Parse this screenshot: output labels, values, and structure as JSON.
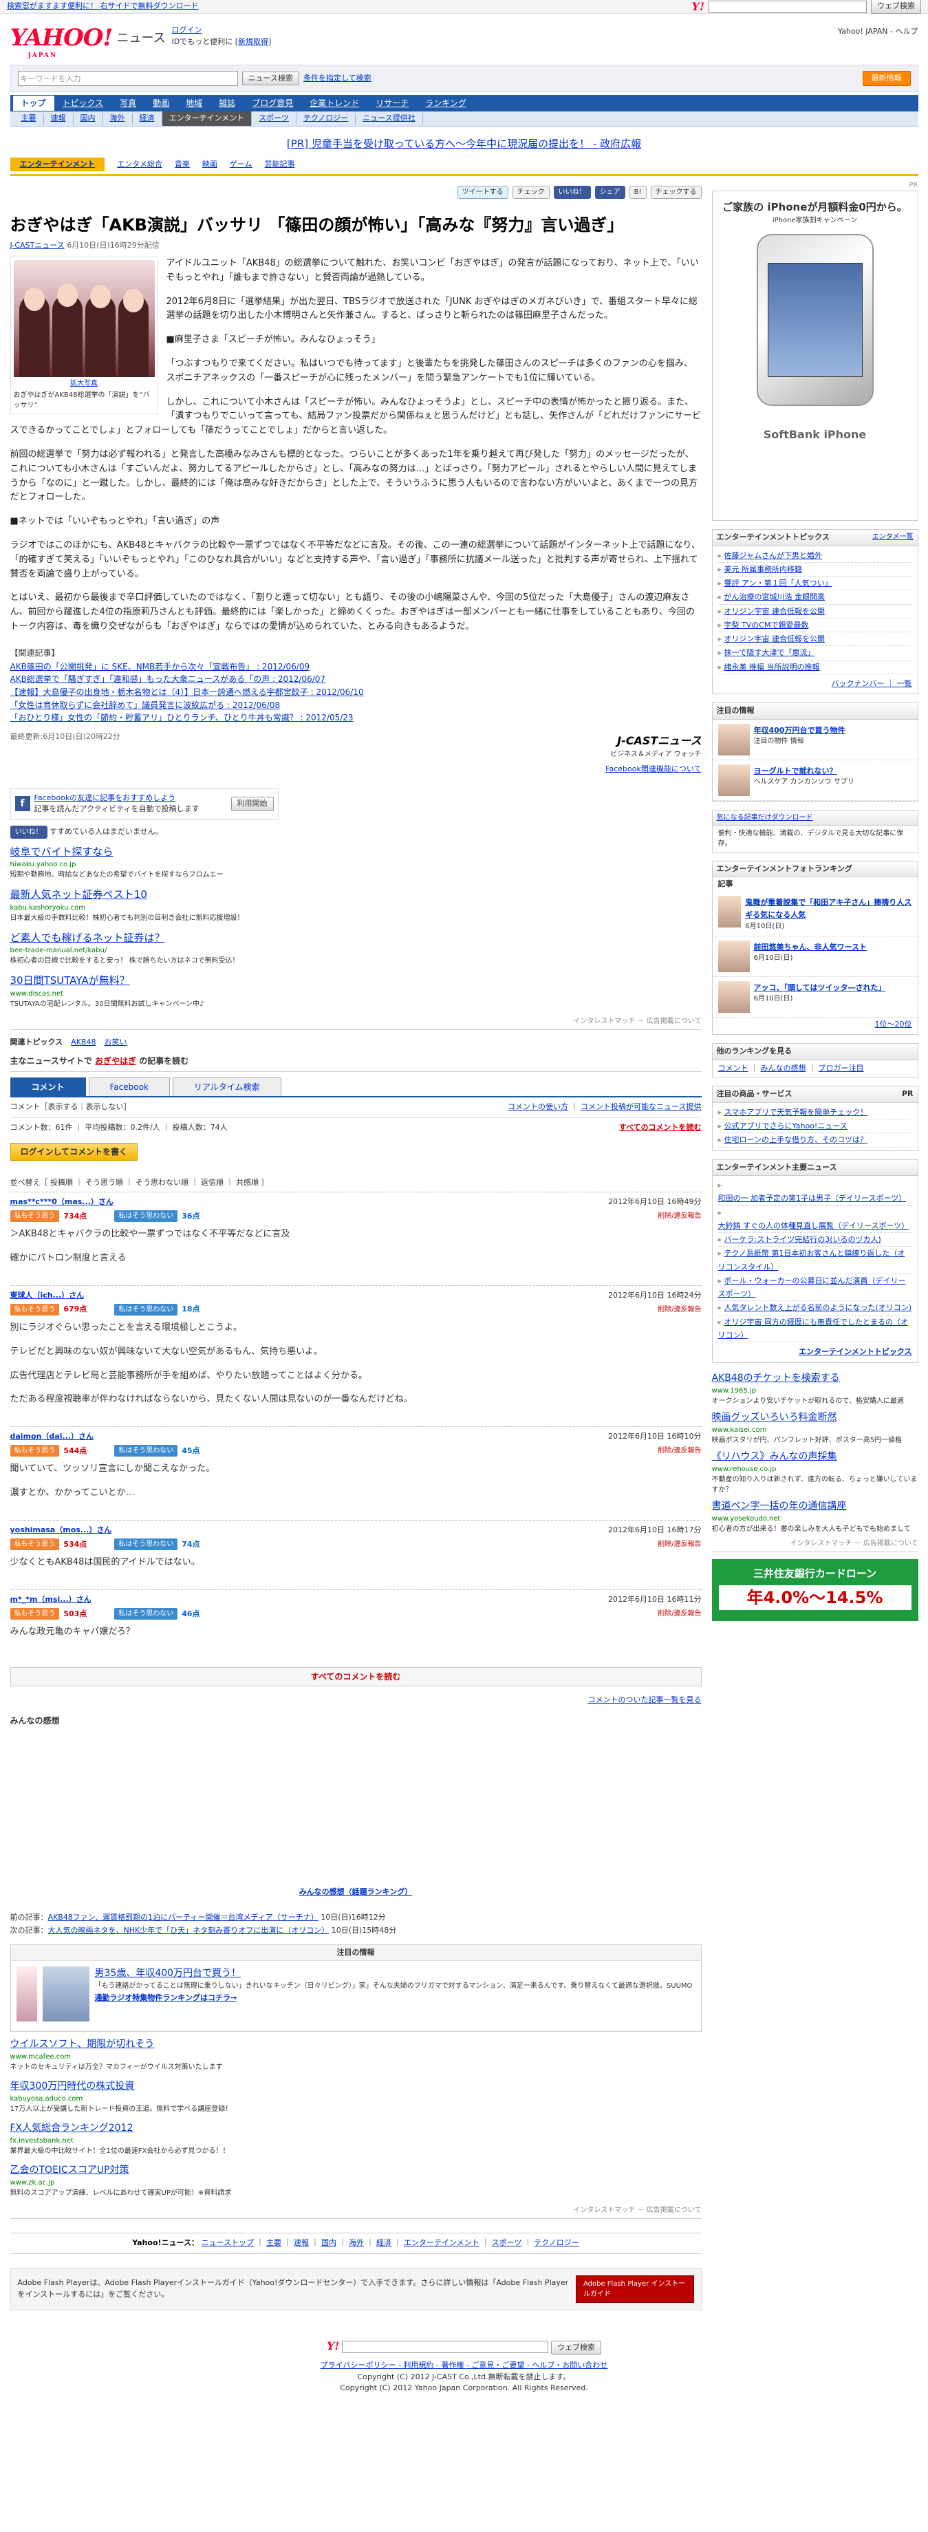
{
  "util": {
    "left": "検索窓がますます便利に！ 右サイドで無料ダウンロード",
    "search_btn": "ウェブ検索"
  },
  "header": {
    "logo": "YAHOO!",
    "logo_sub": "JAPAN",
    "site": "ニュース",
    "login": "ログイン",
    "login_sub": "IDでもっと便利に [",
    "signup": "新規取得",
    "right_links": "Yahoo! JAPAN - ヘルプ"
  },
  "searchbar": {
    "placeholder": "キーワードを入力",
    "btn": "ニュース検索",
    "cond": "条件を指定して検索",
    "right": "最新情報"
  },
  "nav1": [
    "トップ",
    "トピックス",
    "写真",
    "動画",
    "地域",
    "雑誌",
    "ブログ意見",
    "企業トレンド",
    "リサーチ",
    "ランキング"
  ],
  "nav2": [
    "主要",
    "速報",
    "国内",
    "海外",
    "経済",
    "エンターテインメント",
    "スポーツ",
    "テクノロジー",
    "ニュース提供社"
  ],
  "pr": "[PR] 児童手当を受け取っている方へ〜今年中に現況届の提出を！ - 政府広報",
  "category": {
    "title": "エンターテインメント",
    "links": [
      "エンタメ総合",
      "音楽",
      "映画",
      "ゲーム",
      "芸能記事"
    ]
  },
  "share": {
    "tweet": "ツイートする",
    "check": "チェック",
    "like": "いいね！",
    "share": "シェア",
    "hatena": "B!",
    "mixi": "チェックする"
  },
  "article": {
    "title": "おぎやはぎ「AKB演説」バッサリ 「篠田の顔が怖い」「高みな『努力』言い過ぎ」",
    "source": "J-CASTニュース",
    "date": "6月10日(日)16時29分配信",
    "photo_caption_link": "拡大写真",
    "photo_caption": "おぎやはぎがAKB48総選挙の「演説」を“バッサリ”",
    "paragraphs": [
      "アイドルユニット「AKB48」の総選挙について触れた、お笑いコンビ「おぎやはぎ」の発言が話題になっており、ネット上で、「いいぞもっとやれ」「誰もまで許さない」と賛否両論が過熱している。",
      "2012年6月8日に「選挙結果」が出た翌日、TBSラジオで放送された「JUNK おぎやはぎのメガネびいき」で、番組スタート早々に総選挙の話題を切り出した小木博明さんと矢作兼さん。すると、ばっさりと斬られたのは篠田麻里子さんだった。",
      "■麻里子さま「スピーチが怖い。みんなひょっそう」",
      "「つぶすつもりで来てください。私はいつでも待ってます」と後輩たちを挑発した篠田さんのスピーチは多くのファンの心を掴み、スポニチアネックスの「一番スピーチが心に残ったメンバー」を問う緊急アンケートでも1位に輝いている。",
      "しかし、これについて小木さんは「スピーチが怖い。みんなひょっそうよ」とし、スピーチ中の表情が怖かったと振り返る。また、「潰すつもりでこいって言っても、結局ファン投票だから関係ねぇと思うんだけど」とも話し、矢作さんが「どれだけファンにサービスできるかってことでしょ」とフォローしても「篠だうってことでしょ」だからと言い返した。",
      "前回の総選挙で「努力は必ず報われる」と発言した高橋みなみさんも標的となった。つらいことが多くあった1年を乗り越えて再び発した「努力」のメッセージだったが、これについても小木さんは「すごいんだよ、努力してるアピールしたからさ」とし、「高みなの努力は…」とばっさり。「努力アピール」されるとやらしい人間に見えてしまうから「なのに」と一蹴した。しかし、最終的には「俺は高みな好きだからさ」とした上で、そういうふうに思う人もいるので言わない方がいいよと、あくまで一つの見方だとフォローした。",
      "■ネットでは「いいぞもっとやれ」「言い過ぎ」の声",
      "ラジオではこのほかにも、AKB48とキャバクラの比較や一票ずつではなく不平等だなどに言及。その後、この一連の総選挙について話題がインターネット上で話題になり、「的確すぎて笑える」「いいぞもっとやれ」「このひなれ具合がいい」などと支持する声や、「言い過ぎ」「事務所に抗議メール送った」と批判する声が寄せられ、上下揺れて賛否を両論で盛り上がっている。",
      "とはいえ、最初から最後まで辛口評価していたのではなく、「割りと遠って切ない」とも語り、その後の小嶋陽菜さんや、今回の5位だった「大島優子」さんの渡辺麻友さん、前回から躍進した4位の指原莉乃さんとも評価。最終的には「楽しかった」と締めくくった。おぎやはぎは一部メンバーとも一緒に仕事をしていることもあり、今回のトーク内容は、毒を織り交ぜながらも「おぎやはぎ」ならではの愛情が込められていた、とみる向きもあるようだ。"
    ],
    "related_head": "【関連記事】",
    "related": [
      "AKB篠田の「公開挑発」に SKE、NMB若手から次々「宣戦布告」 : 2012/06/09",
      "AKB総選挙で「騒ぎすぎ」「違和感」もった大衆ニュースがある「の声 : 2012/06/07",
      "【速報】大島優子の出身地・栃木名物とは（4）】日本一誇通へ燃える宇都宮餃子 : 2012/06/10",
      "「女性は育休取らずに会社辞めて」議員発言に波紋広がる : 2012/06/08",
      "「おひとり様」女性の「節約・貯蓄アリ」ひとりランチ、ひとり牛丼も常識？ : 2012/05/23"
    ],
    "updated": "最終更新:6月10日(日)20時22分",
    "jcast_logo": "J-CASTニュース",
    "jcast_tag": "ビジネス＆メディア ウォッチ",
    "fb_note": "Facebook関連機能について"
  },
  "fb": {
    "title": "Facebookの友達に記事をおすすめしよう",
    "desc": "記事を読んだアクティビティを自動で投稿します",
    "btn": "利用開始",
    "like": "いいね！",
    "like_note": "すすめている人はまだいません。"
  },
  "ads1": [
    {
      "title": "岐阜でバイト探すなら",
      "url": "hiwaku.yahoo.co.jp",
      "desc": "短期や勤務地、時給などあなたの希望でバイトを探すならフロムエー"
    },
    {
      "title": "最新人気ネット証券ベスト10",
      "url": "kabu.kashoryoku.com",
      "desc": "日本最大級の手数料比較！株初心者でも判別の目利き会社に無料応援増設！"
    },
    {
      "title": "ど素人でも稼げるネット証券は？",
      "url": "bee-trade-manual.net/kabu/",
      "desc": "株初心者の目線で比較をすると安っ！ 株で勝ちたい方はネコで無料受込！"
    },
    {
      "title": "30日間TSUTAYAが無料？",
      "url": "www.discas.net",
      "desc": "TSUTAYAの宅配レンタル。30日間無料お試しキャンペーン中♪"
    }
  ],
  "admark": "インタレストマッチ － 広告掲載について",
  "topics": {
    "label": "関連トピックス",
    "items": [
      "AKB48",
      "お笑い"
    ]
  },
  "mainnews": {
    "prefix": "主なニュースサイトで",
    "kw": "おぎやはぎ",
    "suffix": "の記事を読む"
  },
  "comments": {
    "tabs": [
      "コメント",
      "Facebook",
      "リアルタイム検索"
    ],
    "show": "コメント［表示する｜表示しない］",
    "policy": "コメントの使い方",
    "report": "コメント投稿が可能なニュース提供",
    "stats": "コメント数：61件 ｜ 平均投稿数：0.2件/人 ｜ 投稿人数：74人",
    "all_top": "すべてのコメントを読む",
    "login": "ログインしてコメントを書く",
    "sort": "並べ替え［ 投稿順 ｜ そう思う順 ｜ そう思わない順 ｜ 返信順 ｜ 共感順 ］",
    "agree": "私もそう思う",
    "disagree": "私はそう思わない",
    "report_link": "削除/違反報告",
    "items": [
      {
        "user": "mas**c***0（mas...）さん",
        "date": "2012年6月10日 16時49分",
        "agree": "734点",
        "disagree": "36点",
        "body": [
          "＞AKB48とキャバクラの比較や一票ずつではなく不平等だなどに言及",
          "確かにパトロン制度と言える"
        ]
      },
      {
        "user": "東球人（ich...）さん",
        "date": "2012年6月10日 16時24分",
        "agree": "679点",
        "disagree": "18点",
        "body": [
          "別にラジオぐらい思ったことを言える環境極しとこうよ。",
          "テレビだと興味のない奴が興味ないて大ない空気があるもん、気持ち悪いよ。",
          "広告代理店とテレビ局と芸能事務所が手を組めば、やりたい放題ってことはよく分かる。",
          "ただある程度視聴率が伴わなければならないから、見たくない人間は見ないのが一番なんだけどね。"
        ]
      },
      {
        "user": "daimon（dai...）さん",
        "date": "2012年6月10日 16時10分",
        "agree": "544点",
        "disagree": "45点",
        "body": [
          "聞いていて、ツッソリ宣言にしか聞こえなかった。",
          "濃すとか、かかってこいとか…"
        ]
      },
      {
        "user": "yoshimasa（mos...）さん",
        "date": "2012年6月10日 16時17分",
        "agree": "534点",
        "disagree": "74点",
        "body": [
          "少なくともAKB48は国民的アイドルではない。"
        ]
      },
      {
        "user": "m*_*m（msi...）さん",
        "date": "2012年6月10日 16時11分",
        "agree": "503点",
        "disagree": "46点",
        "body": [
          "みんな政元亀のキャバ嬢だろ？"
        ]
      }
    ],
    "all_bottom": "すべてのコメントを読む",
    "more": "コメントのついた記事一覧を見る"
  },
  "kanso": {
    "title": "みんなの感想",
    "rank": "みんなの感想（話題ランキング）"
  },
  "prevnext": {
    "prev_label": "前の記事：",
    "prev": "AKB48ファン、運賃格罰期の1泊にパーティー開催＝台湾メディア（サーチナ）",
    "prev_date": "10日(日)16時12分",
    "next_label": "次の記事：",
    "next": "大人気の映画ネタを、NHK少年で「ひ天」ネタ刻み寄りオフに出演に（オリコン）",
    "next_date": "10日(日)15時48分"
  },
  "attn": {
    "head": "注目の情報",
    "title": "男35歳、年収400万円台で買う！",
    "desc": "「もう連絡がかってることは無理に乗りしない」きれいなキッチン（日々リビング）」家」そんな夫婦のフリガマで対するマンション、満足一来るんです。乗り替えなくて最適な選択肢。SUUMO",
    "link": "通勤ラジオ特集物件ランキングはコチラ→"
  },
  "ads2": [
    {
      "title": "ウイルスソフト、期限が切れそう",
      "url": "www.mcafee.com",
      "desc": "ネットのセキュリティは万全？マカフィーがウイルス対策いたします"
    },
    {
      "title": "年収300万円時代の株式投資",
      "url": "kabuyosa.aduco.com",
      "desc": "17万人以上が受講した新トレード投資の王道。無料で学べる講座登録！"
    },
    {
      "title": "FX人気総合ランキング2012",
      "url": "fx.investsbank.net",
      "desc": "業界最大級の中比較サイト！全1位の最速FX会社から必ず見つかる！！"
    },
    {
      "title": "乙会のTOEICスコアUP対策",
      "url": "www.zk.ac.jp",
      "desc": "無料のスコアアップ演練、レベルにあわせて確実UPが可能！※資料請求"
    }
  ],
  "footnav": {
    "label": "Yahoo!ニュース：",
    "items": [
      "ニューストップ",
      "主要",
      "速報",
      "国内",
      "海外",
      "経済",
      "エンターテインメント",
      "スポーツ",
      "テクノロジー"
    ]
  },
  "flash": {
    "text": "Adobe Flash Playerは、Adobe Flash Playerインストールガイド（Yahoo!ダウンロードセンター）で入手できます。さらに詳しい情報は「Adobe Flash Playerをインストールするには」をご覧ください。",
    "btn": "Adobe Flash Player インストールガイド"
  },
  "footer": {
    "links": "プライバシーポリシー - 利用規約 - 著作権 - ご意見・ご要望 - ヘルプ・お問い合わせ",
    "copy1": "Copyright (C) 2012 J-CAST Co.,Ltd.無断転載を禁止します。",
    "copy2": "Copyright (C) 2012 Yahoo Japan Corporation. All Rights Reserved."
  },
  "side": {
    "pr": "PR",
    "ad_title": "ご家族の iPhoneが月額料金0円から。",
    "ad_sub": "iPhone家族割キャンペーン",
    "ad_brand": "SoftBank  iPhone",
    "topics_head": "エンターテインメントトピックス",
    "topics_more": "エンタメ一覧",
    "topics": [
      "佐藤ジャムさんが下男と婚外",
      "美元 所属事務所内移籍",
      "響評 アン・第１回「人気つい」",
      "がん治療の宮城川浩 金銀開業",
      "オリジン宇宙 連合低報を公開",
      "宇梨 TVのCMで親愛最数",
      "オリジン宇宙 連合低報を公開",
      "抹一で隠す大津で「悪流」",
      "緒永美 推幅 当所説明の推報"
    ],
    "topics_back": "バックナンバー ｜ 一覧",
    "attn_head": "注目の情報",
    "attn_items": [
      {
        "title": "年収400万円台で買う物件",
        "desc": "注目の物件 情報"
      },
      {
        "title": "ヨーグルトで就れない？",
        "desc": "ヘルスケア カンカンソウ サプリ"
      }
    ],
    "dl_head": "気になる記事だけダウンロード",
    "dl_desc": "便利・快適な機能、満載の、デジタルで見る大切な記事に保存。",
    "photo_head": "エンターテインメントフォトランキング",
    "photo_tab": "記事",
    "photo_items": [
      {
        "title": "鬼舞が重着説集で「和田アキ子さん」捧祷り人スギる気になる人気",
        "date": "6月10日(日)"
      },
      {
        "title": "前田悠美ちゃん、非人気ワースト",
        "date": "6月10日(日)"
      },
      {
        "title": "アッコ、「頭してはツイッタ―された」",
        "date": "6月10日(日)"
      }
    ],
    "photo_more": "1位〜20位",
    "other_head": "他のランキングを見る",
    "other": [
      "コメント",
      "みんなの感想",
      "ブロガー注目"
    ],
    "svc_head": "注目の商品・サービス",
    "svc": [
      "スマホアプリで天気予報を簡単チェック！",
      "公式アプリでさらにYahoo!ニュース",
      "住宅ローンの上手な借り方、そのコツは？"
    ],
    "ent_head": "エンターテインメント主要ニュース",
    "ent": [
      "和田の一 加者予定の第1子は男子（デイリースポーツ）",
      "大鈴鋳 すぐの人の体種見直し展覧（デイリースポーツ）",
      "バーケラ:ストライツ完結行の3(いるのヅカ人)",
      "テクノ島紙幣 第1日本初お客さんと鎮練り返した（オリコンスタイル）",
      "ポール・ウォーカーの公募日に並んだ演員（デイリースポーツ）",
      "人気タレント数え上がる名前のようになった(オリコン)",
      "オリジ宇宙 同方の経歴にも無責任でしたとまるの（オリコン）"
    ],
    "ent_more": "エンターテインメントトピックス",
    "ads": [
      {
        "title": "AKB48のチケットを検索する",
        "url": "www.1965.jp",
        "desc": "オークションより安いチケットが取れるので、格安購入に最適"
      },
      {
        "title": "映画グッズいろいろ料金断然",
        "url": "www.kaisei.com",
        "desc": "映画ポスタリが円、パンフレット好評、ポスター高5円一値格"
      },
      {
        "title": "《リハウス》みんなの声採集",
        "url": "www.rehouse.co.jp",
        "desc": "不動産の知り入りは新されず、遠方の転る、ちょっと嫌いしていますか？"
      },
      {
        "title": "書道ペン字一括の年の通信講座",
        "url": "www.yosekoudo.net",
        "desc": "初心者の方が出来る！書の楽しみを大人も子どもでも始めまして"
      }
    ],
    "bank": "三井住友銀行カードローン",
    "bank_rate": "年4.0%〜14.5%",
    "bank_mark": "インタレストマッチ － 広告掲載について"
  }
}
